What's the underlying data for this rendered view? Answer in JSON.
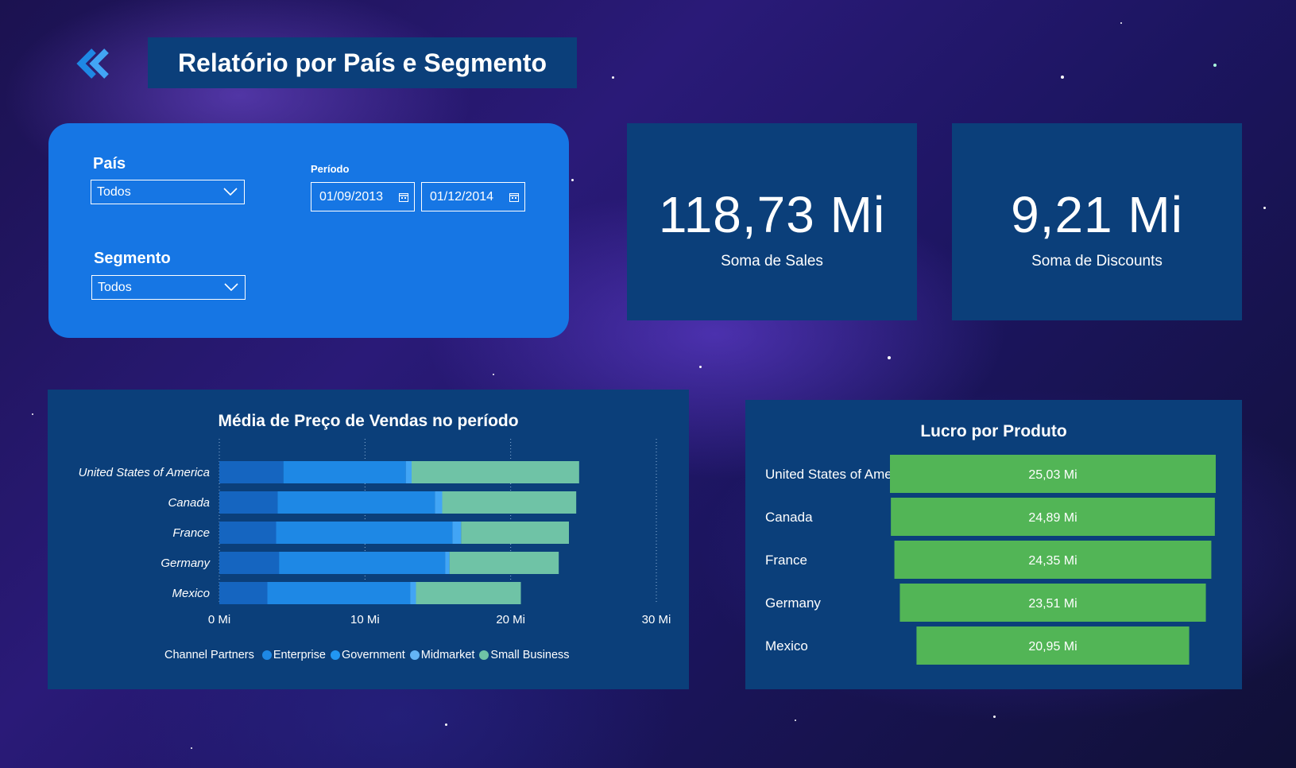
{
  "header": {
    "title": "Relatório por País e Segmento",
    "back_icon": "double-chevron-left-icon"
  },
  "filters": {
    "pais_label": "País",
    "pais_value": "Todos",
    "segmento_label": "Segmento",
    "segmento_value": "Todos",
    "periodo_label": "Período",
    "date_start": "01/09/2013",
    "date_end": "01/12/2014",
    "dropdown_icon": "chevron-down-icon",
    "date_icon": "calendar-icon"
  },
  "kpis": [
    {
      "value": "118,73 Mi",
      "label": "Soma de  Sales"
    },
    {
      "value": "9,21 Mi",
      "label": "Soma de Discounts"
    }
  ],
  "colors": {
    "panel": "#0b3f7a",
    "filter_panel": "#1676e4",
    "channel_partners": "#1565c0",
    "enterprise": "#1e88e5",
    "government": "#42a5f5",
    "midmarket": "#64b5f6",
    "small_business": "#6fc3a6",
    "profit_bar": "#52b556"
  },
  "chart_data": [
    {
      "type": "bar",
      "orientation": "horizontal",
      "stacked": true,
      "title": "Média de Preço de Vendas no período",
      "categories": [
        "United States of America",
        "Canada",
        "France",
        "Germany",
        "Mexico"
      ],
      "series": [
        {
          "name": "Channel Partners",
          "values": [
            4.4,
            4.0,
            3.9,
            4.1,
            3.3
          ]
        },
        {
          "name": "Enterprise",
          "values": [
            8.4,
            10.8,
            12.1,
            11.4,
            9.8
          ]
        },
        {
          "name": "Government",
          "values": [
            0.4,
            0.5,
            0.6,
            0.3,
            0.4
          ]
        },
        {
          "name": "Midmarket",
          "values": [
            0.0,
            0.0,
            0.0,
            0.0,
            0.0
          ]
        },
        {
          "name": "Small Business",
          "values": [
            11.5,
            9.2,
            7.4,
            7.5,
            7.2
          ]
        }
      ],
      "xticks": [
        "0 Mi",
        "10 Mi",
        "20 Mi",
        "30 Mi"
      ],
      "xlim": [
        0,
        30
      ],
      "grid": true,
      "legend": "bottom"
    },
    {
      "type": "bar",
      "orientation": "horizontal",
      "style": "funnel",
      "title": "Lucro por Produto",
      "categories": [
        "United States of Ameri...",
        "Canada",
        "France",
        "Germany",
        "Mexico"
      ],
      "values": [
        25.03,
        24.89,
        24.35,
        23.51,
        20.95
      ],
      "labels": [
        "25,03 Mi",
        "24,89 Mi",
        "24,35 Mi",
        "23,51 Mi",
        "20,95 Mi"
      ]
    }
  ]
}
